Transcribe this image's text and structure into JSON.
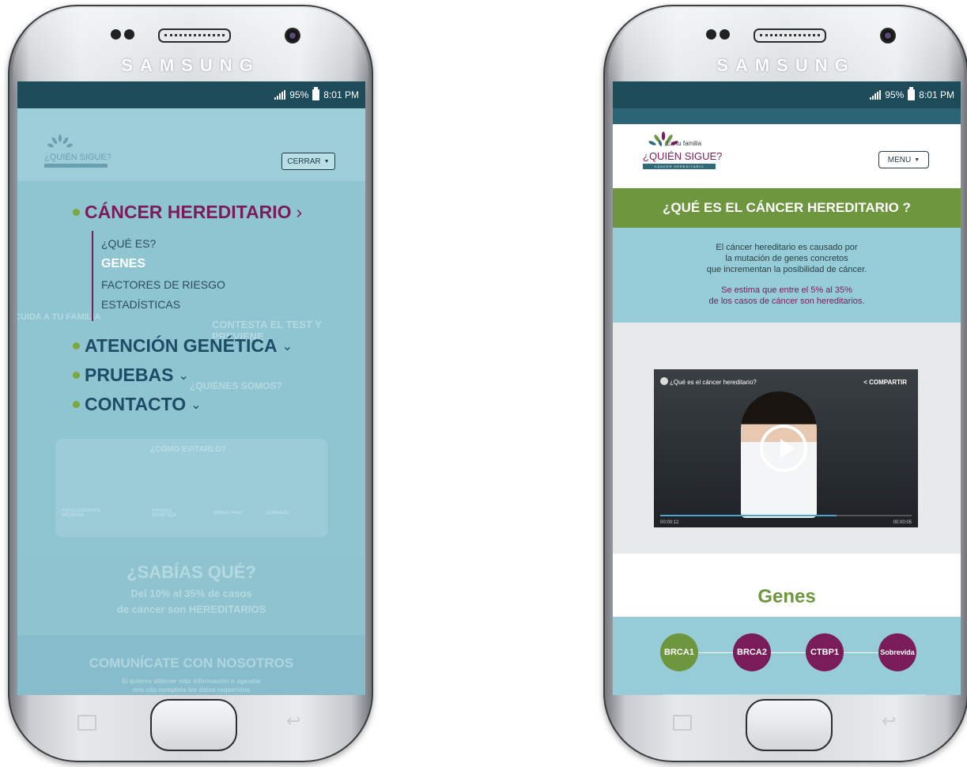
{
  "brand": "SAMSUNG",
  "status": {
    "battery": "95%",
    "time": "8:01 PM"
  },
  "left": {
    "close_label": "CERRAR",
    "menu": [
      {
        "label": "CÁNCER HEREDITARIO",
        "chevron": "›"
      },
      {
        "label": "ATENCIÓN GENÉTICA",
        "chevron": "⌄"
      },
      {
        "label": "PRUEBAS",
        "chevron": "⌄"
      },
      {
        "label": "CONTACTO",
        "chevron": "⌄"
      }
    ],
    "submenu": [
      "¿QUÉ ES?",
      "GENES",
      "FACTORES DE RIESGO",
      "ESTADÍSTICAS"
    ],
    "bg": {
      "cuida": "CUIDA A TU FAMILIA",
      "contesta": "CONTESTA EL TEST Y PREVIENE",
      "quienes": "¿QUIÉNES SOMOS?",
      "como": "¿CÓMO EVITARLO?",
      "steps": [
        "ANTECEDENTES MÉDICOS",
        "PRUEBA GENÉTICA",
        "RESULTADO",
        "CONSEJO"
      ],
      "sabias": "¿SABÍAS QUÉ?",
      "stat1": "Del 10% al 35% de casos",
      "stat2": "de cáncer son HEREDITARIOS",
      "comunicate": "COMUNÍCATE CON NOSOTROS",
      "com_sub1": "Si quieres obtener más información o agendar",
      "com_sub2": "una cita completa los datos requeridos"
    }
  },
  "logo": {
    "line1": "En tu familia",
    "line2": "¿QUIÉN SIGUE?",
    "line3": "CÁNCER HEREDITARIO"
  },
  "right": {
    "menu_label": "MENU",
    "title": "¿QUÉ ES EL CÁNCER HEREDITARIO ?",
    "info": [
      "El cáncer hereditario es causado por",
      "la mutación de genes concretos",
      "que incrementan la posibilidad de cáncer."
    ],
    "info_hl": [
      "Se estima que entre el 5% al 35%",
      "de los casos de cáncer son hereditarios."
    ],
    "video": {
      "title": "¿Qué es el cáncer hereditario?",
      "share": "COMPARTIR",
      "time_cur": "00:00:12",
      "time_total": "00:00:05",
      "progress": 0.7
    },
    "genes_title": "Genes",
    "genes": [
      "BRCA1",
      "BRCA2",
      "CTBP1",
      "Sobrevida"
    ]
  }
}
